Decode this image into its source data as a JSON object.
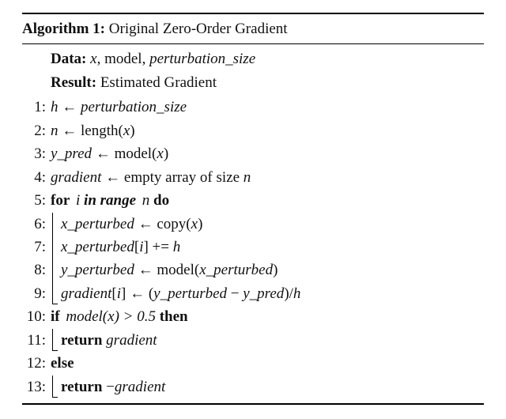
{
  "header": {
    "algo_label": "Algorithm 1:",
    "title": "Original Zero-Order Gradient"
  },
  "meta": {
    "data_label": "Data:",
    "data_value_plain1": "x",
    "data_value_plain2": ", model, ",
    "data_value_italic": "perturbation_size",
    "result_label": "Result:",
    "result_value": "Estimated Gradient"
  },
  "lines": {
    "l1": {
      "n": "1:",
      "lhs": "h",
      "arrow": "←",
      "rhs": "perturbation_size"
    },
    "l2": {
      "n": "2:",
      "lhs": "n",
      "arrow": "←",
      "rhs1": "length(",
      "rhs2": "x",
      "rhs3": ")"
    },
    "l3": {
      "n": "3:",
      "lhs": "y_pred",
      "arrow": "←",
      "rhs1": "model(",
      "rhs2": "x",
      "rhs3": ")"
    },
    "l4": {
      "n": "4:",
      "lhs": "gradient",
      "arrow": "←",
      "rhs1": "empty array of size ",
      "rhs2": "n"
    },
    "l5": {
      "n": "5:",
      "for": "for",
      "var": "i",
      "inrange": "in range",
      "limit": "n",
      "do": "do"
    },
    "l6": {
      "n": "6:",
      "lhs": "x_perturbed",
      "arrow": "←",
      "rhs1": "copy(",
      "rhs2": "x",
      "rhs3": ")"
    },
    "l7": {
      "n": "7:",
      "lhs": "x_perturbed",
      "idx": "[",
      "idxvar": "i",
      "idx2": "] += ",
      "rhs": "h"
    },
    "l8": {
      "n": "8:",
      "lhs": "y_perturbed",
      "arrow": "←",
      "rhs1": "model(",
      "rhs2": "x_perturbed",
      "rhs3": ")"
    },
    "l9": {
      "n": "9:",
      "lhs": "gradient",
      "idx": "[",
      "idxvar": "i",
      "idx2": "]",
      "arrow": "←",
      "p1": "(",
      "a": "y_perturbed",
      "minus": " − ",
      "b": "y_pred",
      "p2": ")/",
      "h": "h"
    },
    "l10": {
      "n": "10:",
      "if": "if",
      "cond1": "model",
      "cond2": "(",
      "cond3": "x",
      "cond4": ") > 0.5",
      "then": "then"
    },
    "l11": {
      "n": "11:",
      "ret": "return",
      "val": "gradient"
    },
    "l12": {
      "n": "12:",
      "else": "else"
    },
    "l13": {
      "n": "13:",
      "ret": "return",
      "neg": "−",
      "val": "gradient"
    }
  }
}
